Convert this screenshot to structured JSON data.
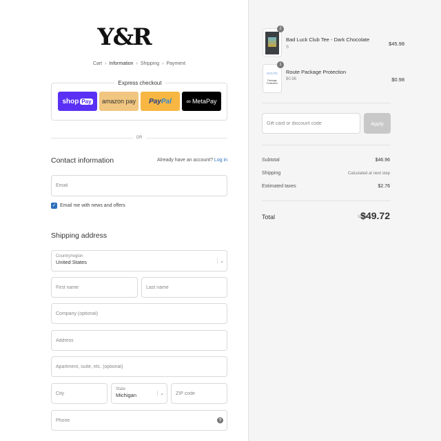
{
  "brand": {
    "logo_text": "Y&R"
  },
  "breadcrumb": {
    "cart": "Cart",
    "information": "Information",
    "shipping": "Shipping",
    "payment": "Payment"
  },
  "express": {
    "title": "Express checkout",
    "shop_pay": {
      "shop": "shop",
      "pay": "Pay"
    },
    "amazon_pay": "amazon pay",
    "paypal": {
      "pay": "Pay",
      "pal": "Pal"
    },
    "meta_pay": "MetaPay",
    "or_text": "OR"
  },
  "contact": {
    "title": "Contact information",
    "account_prompt": "Already have an account?",
    "login_link": "Log in",
    "email_placeholder": "Email",
    "newsletter_label": "Email me with news and offers",
    "newsletter_checked": true
  },
  "shipping": {
    "title": "Shipping address",
    "country_label": "Country/region",
    "country_value": "United States",
    "first_name_placeholder": "First name",
    "last_name_placeholder": "Last name",
    "company_placeholder": "Company (optional)",
    "address_placeholder": "Address",
    "apartment_placeholder": "Apartment, suite, etc. (optional)",
    "city_placeholder": "City",
    "state_label": "State",
    "state_value": "Michigan",
    "zip_placeholder": "ZIP code",
    "phone_placeholder": "Phone"
  },
  "order": {
    "items": [
      {
        "name": "Bad Luck Club Tee - Dark Chocolate",
        "variant": "S",
        "price": "$45.98",
        "quantity": "2"
      },
      {
        "name": "Route Package Protection",
        "variant": "$0.98",
        "price": "$0.98",
        "quantity": "1",
        "thumb_brand": "ROUTE",
        "thumb_caption": "Package Protection"
      }
    ],
    "discount_placeholder": "Gift card or discount code",
    "apply_label": "Apply",
    "subtotal_label": "Subtotal",
    "subtotal_value": "$46.96",
    "shipping_label": "Shipping",
    "shipping_value": "Calculated at next step",
    "taxes_label": "Estimated taxes",
    "taxes_value": "$2.76",
    "total_label": "Total",
    "currency": "USD",
    "total_value": "$49.72"
  },
  "colors": {
    "accent": "#2a6ebb",
    "shop_pay": "#5a31f4",
    "amazon_pay": "#f0c680",
    "paypal": "#f7b742",
    "meta_pay": "#000000",
    "apply_disabled": "#c8c8c8"
  }
}
